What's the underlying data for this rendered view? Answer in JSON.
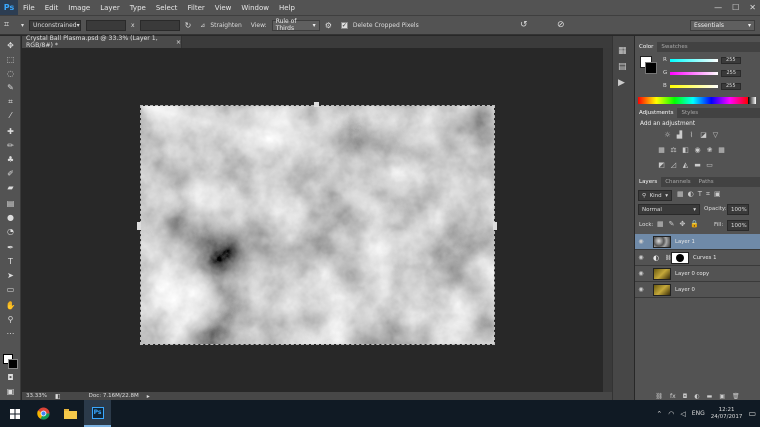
{
  "app": {
    "logo": "Ps"
  },
  "menu": [
    "File",
    "Edit",
    "Image",
    "Layer",
    "Type",
    "Select",
    "Filter",
    "View",
    "Window",
    "Help"
  ],
  "window_controls": {
    "minimize": "—",
    "maximize": "☐",
    "close": "✕"
  },
  "options_bar": {
    "ratio_select": "Unconstrained",
    "width_value": "",
    "height_value": "",
    "swap_symbol": "x",
    "straighten_label": "Straighten",
    "view_label": "View:",
    "view_select": "Rule of Thirds",
    "delete_cropped_label": "Delete Cropped Pixels",
    "delete_cropped_checked": true,
    "workspace_select": "Essentials"
  },
  "document": {
    "tab_title": "Crystal Ball Plasma.psd @ 33.3% (Layer 1, RGB/8#) *",
    "tab_close": "×",
    "zoom": "33.33%",
    "doc_info": "Doc: 7.16M/22.8M"
  },
  "color_panel": {
    "tabs": [
      "Color",
      "Swatches"
    ],
    "channels": [
      {
        "label": "R",
        "value": "255",
        "color": "#ff3030"
      },
      {
        "label": "G",
        "value": "255",
        "color": "#30ff30"
      },
      {
        "label": "B",
        "value": "255",
        "color": "#3030ff"
      }
    ]
  },
  "adjustments_panel": {
    "tabs": [
      "Adjustments",
      "Styles"
    ],
    "heading": "Add an adjustment"
  },
  "layers_panel": {
    "tabs": [
      "Layers",
      "Channels",
      "Paths"
    ],
    "filter_kind": "Kind",
    "blend_mode": "Normal",
    "opacity_label": "Opacity:",
    "opacity_value": "100%",
    "lock_label": "Lock:",
    "fill_label": "Fill:",
    "fill_value": "100%",
    "layers": [
      {
        "name": "Layer 1",
        "selected": true,
        "type": "clouds"
      },
      {
        "name": "Curves 1",
        "selected": false,
        "type": "adjustment"
      },
      {
        "name": "Layer 0 copy",
        "selected": false,
        "type": "image"
      },
      {
        "name": "Layer 0",
        "selected": false,
        "type": "image"
      }
    ]
  },
  "taskbar": {
    "language": "ENG",
    "time": "12:21",
    "date": "24/07/2017"
  }
}
